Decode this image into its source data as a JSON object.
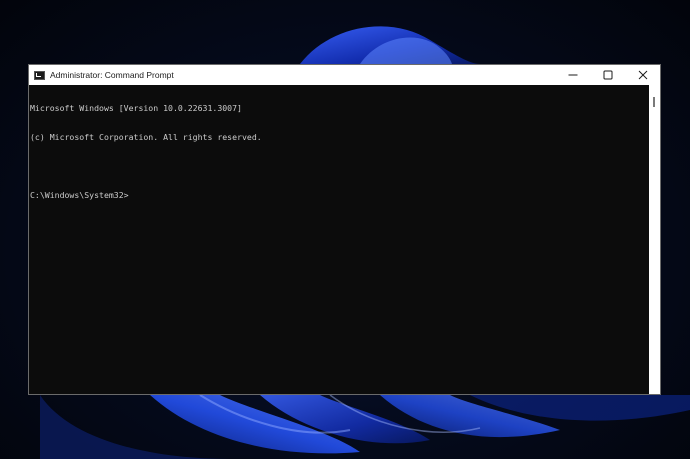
{
  "window": {
    "title": "Administrator: Command Prompt",
    "icon": "cmd-icon"
  },
  "caption_buttons": {
    "minimize": "minimize-icon",
    "maximize": "maximize-icon",
    "close": "close-icon"
  },
  "console": {
    "lines": [
      "Microsoft Windows [Version 10.0.22631.3007]",
      "(c) Microsoft Corporation. All rights reserved.",
      "",
      "C:\\Windows\\System32>"
    ]
  },
  "colors": {
    "console_background": "#0c0c0c",
    "console_text": "#cccccc",
    "titlebar": "#ffffff",
    "wallpaper_accent": "#1d3fd6"
  }
}
